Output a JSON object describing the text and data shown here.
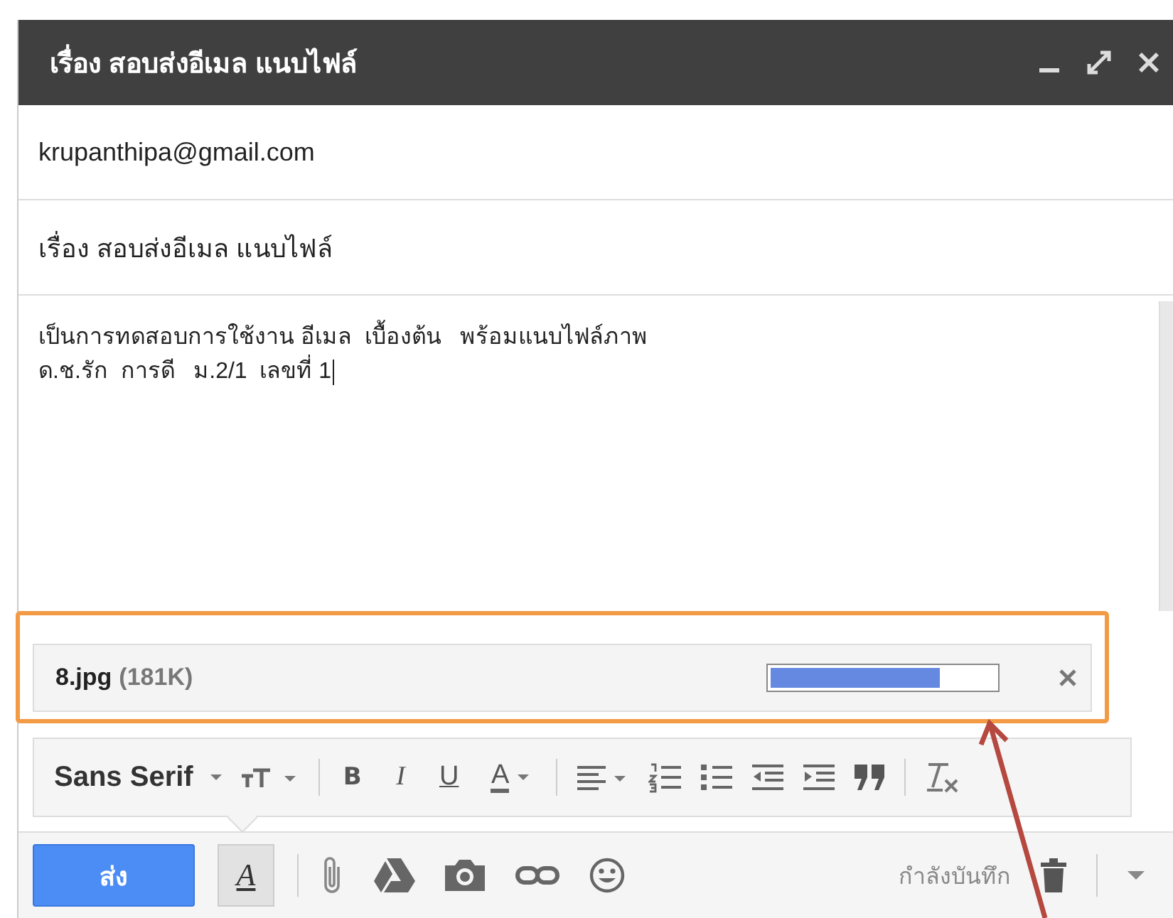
{
  "window": {
    "title": "เรื่อง สอบส่งอีเมล แนบไฟล์"
  },
  "recipient": "krupanthipa@gmail.com",
  "subject": "เรื่อง  สอบส่งอีเมล  แนบไฟล์",
  "body_lines": [
    "เป็นการทดสอบการใช้งาน อีเมล  เบื้องต้น   พร้อมแนบไฟล์ภาพ",
    "ด.ช.รัก  การดี   ม.2/1  เลขที่ 1"
  ],
  "attachment": {
    "name": "8.jpg",
    "size": "(181K)",
    "level": 0.75
  },
  "format_toolbar": [
    {
      "kind": "font",
      "label": "Sans Serif"
    },
    {
      "kind": "size"
    },
    {
      "kind": "sep"
    },
    {
      "kind": "bold",
      "label": "B"
    },
    {
      "kind": "italic",
      "label": "I"
    },
    {
      "kind": "underline",
      "label": "U"
    },
    {
      "kind": "color",
      "label": "A"
    },
    {
      "kind": "sep"
    },
    {
      "kind": "align"
    },
    {
      "kind": "numbered"
    },
    {
      "kind": "bulleted"
    },
    {
      "kind": "outdent"
    },
    {
      "kind": "indent"
    },
    {
      "kind": "quote"
    },
    {
      "kind": "sep"
    },
    {
      "kind": "clear"
    }
  ],
  "bottom_bar": {
    "send": "ส่ง",
    "format_toggle": {
      "label": "A",
      "selected": true
    },
    "status": "กำลังบันทึก"
  }
}
